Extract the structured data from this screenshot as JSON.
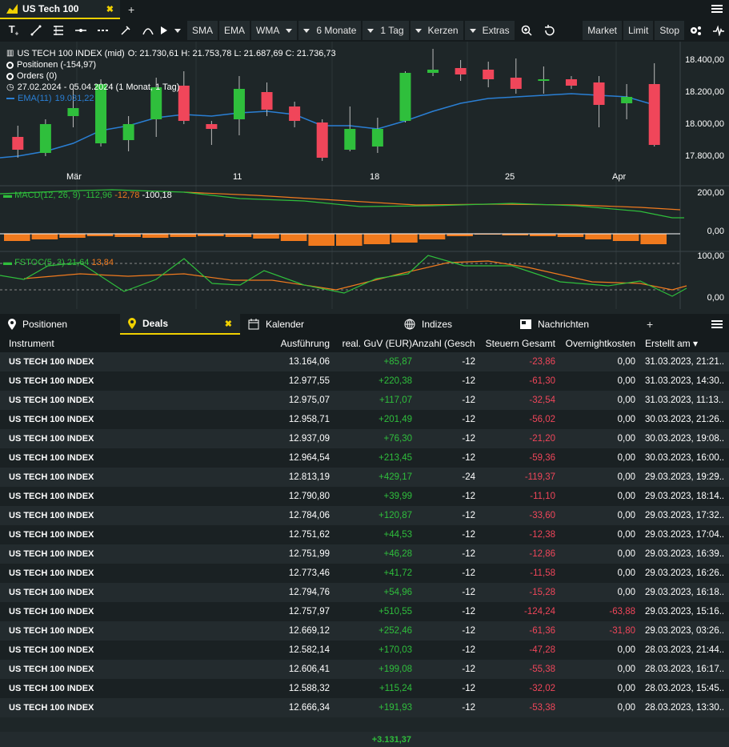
{
  "tab": {
    "title": "US Tech 100"
  },
  "toolbar": {
    "items": [
      {
        "label": "SMA",
        "dd": false
      },
      {
        "label": "EMA",
        "dd": false
      },
      {
        "label": "WMA",
        "dd": true
      },
      {
        "label": "6 Monate",
        "dd": true
      },
      {
        "label": "1 Tag",
        "dd": true
      },
      {
        "label": "Kerzen",
        "dd": true
      },
      {
        "label": "Extras",
        "dd": false
      }
    ],
    "market": "Market",
    "limit": "Limit",
    "stop": "Stop"
  },
  "legend": {
    "instrument": "US TECH 100 INDEX (mid)",
    "ohlc": "O: 21.730,61  H: 21.753,78  L: 21.687,69  C: 21.736,73",
    "positionen": "Positionen (-154,97)",
    "orders": "Orders (0)",
    "range": "27.02.2024 - 05.04.2024   (1 Monat, 1 Tag)",
    "ema": "EMA(11)",
    "ema_val": "19.031,22"
  },
  "colors": {
    "up": "#2fbf3c",
    "down": "#f0465a",
    "ema": "#2a7fd4",
    "macd": "#2fbf3c",
    "signal": "#f07a1e",
    "accent": "#f0d000"
  },
  "chart_data": {
    "type": "candlestick",
    "y_ticks": [
      "18.400,00",
      "18.200,00",
      "18.000,00",
      "17.800,00"
    ],
    "x_ticks": [
      "Mär",
      "11",
      "18",
      "25",
      "Apr"
    ],
    "candles": [
      {
        "o": 17920,
        "c": 17840,
        "h": 17990,
        "l": 17790
      },
      {
        "o": 17820,
        "c": 18000,
        "h": 18030,
        "l": 17800
      },
      {
        "o": 18050,
        "c": 18100,
        "h": 18220,
        "l": 17980
      },
      {
        "o": 17880,
        "c": 18250,
        "h": 18280,
        "l": 17860
      },
      {
        "o": 17900,
        "c": 18000,
        "h": 18050,
        "l": 17830
      },
      {
        "o": 18030,
        "c": 18230,
        "h": 18290,
        "l": 17920
      },
      {
        "o": 18240,
        "c": 18020,
        "h": 18330,
        "l": 18000
      },
      {
        "o": 18000,
        "c": 17970,
        "h": 18020,
        "l": 17870
      },
      {
        "o": 18030,
        "c": 18220,
        "h": 18300,
        "l": 17930
      },
      {
        "o": 18200,
        "c": 18090,
        "h": 18260,
        "l": 18050
      },
      {
        "o": 18110,
        "c": 18020,
        "h": 18140,
        "l": 17980
      },
      {
        "o": 18010,
        "c": 17790,
        "h": 18030,
        "l": 17770
      },
      {
        "o": 17840,
        "c": 17970,
        "h": 18110,
        "l": 17830
      },
      {
        "o": 17860,
        "c": 17970,
        "h": 18040,
        "l": 17820
      },
      {
        "o": 18020,
        "c": 18320,
        "h": 18330,
        "l": 18010
      },
      {
        "o": 18320,
        "c": 18340,
        "h": 18470,
        "l": 18300
      },
      {
        "o": 18350,
        "c": 18310,
        "h": 18400,
        "l": 18270
      },
      {
        "o": 18340,
        "c": 18280,
        "h": 18390,
        "l": 18230
      },
      {
        "o": 18290,
        "c": 18220,
        "h": 18410,
        "l": 18190
      },
      {
        "o": 18280,
        "c": 18280,
        "h": 18360,
        "l": 18190
      },
      {
        "o": 18280,
        "c": 18240,
        "h": 18300,
        "l": 18220
      },
      {
        "o": 18260,
        "c": 18120,
        "h": 18300,
        "l": 17980
      },
      {
        "o": 18130,
        "c": 18170,
        "h": 18250,
        "l": 18030
      },
      {
        "o": 18250,
        "c": 17870,
        "h": 18380,
        "l": 17860
      }
    ],
    "ema": [
      17800,
      17830,
      17880,
      17960,
      17990,
      18040,
      18060,
      18050,
      18070,
      18080,
      18060,
      17990,
      17990,
      17970,
      18020,
      18080,
      18130,
      18160,
      18170,
      18180,
      18190,
      18180,
      18170,
      18120
    ]
  },
  "macd": {
    "label": "MACD(12, 26, 9)",
    "v1": "-112,96",
    "v2": "-12,78",
    "v3": "-100,18",
    "ticks": [
      "200,00",
      "0,00"
    ]
  },
  "fstoc": {
    "label": "FSTOC(5, 3)",
    "v1": "21,64",
    "v2": "13,84",
    "ticks": [
      "100,00",
      "0,00"
    ]
  },
  "bottom_tabs": [
    {
      "label": "Positionen",
      "icon": "pin-icon"
    },
    {
      "label": "Deals",
      "icon": "pin-icon"
    },
    {
      "label": "Kalender",
      "icon": "calendar-icon"
    },
    {
      "label": "Indizes",
      "icon": "globe-icon"
    },
    {
      "label": "Nachrichten",
      "icon": "news-icon"
    }
  ],
  "table": {
    "headers": [
      "Instrument",
      "Ausführung",
      "real. GuV (EUR)",
      "Anzahl (Geschl",
      "Steuern Gesamt",
      "Overnightkosten",
      "Erstellt am"
    ],
    "rows": [
      [
        "US TECH 100 INDEX",
        "13.164,06",
        "+85,87",
        "-12",
        "-23,86",
        "0,00",
        "31.03.2023, 21:21..."
      ],
      [
        "US TECH 100 INDEX",
        "12.977,55",
        "+220,38",
        "-12",
        "-61,30",
        "0,00",
        "31.03.2023, 14:30..."
      ],
      [
        "US TECH 100 INDEX",
        "12.975,07",
        "+117,07",
        "-12",
        "-32,54",
        "0,00",
        "31.03.2023, 11:13..."
      ],
      [
        "US TECH 100 INDEX",
        "12.958,71",
        "+201,49",
        "-12",
        "-56,02",
        "0,00",
        "30.03.2023, 21:26..."
      ],
      [
        "US TECH 100 INDEX",
        "12.937,09",
        "+76,30",
        "-12",
        "-21,20",
        "0,00",
        "30.03.2023, 19:08..."
      ],
      [
        "US TECH 100 INDEX",
        "12.964,54",
        "+213,45",
        "-12",
        "-59,36",
        "0,00",
        "30.03.2023, 16:00..."
      ],
      [
        "US TECH 100 INDEX",
        "12.813,19",
        "+429,17",
        "-24",
        "-119,37",
        "0,00",
        "29.03.2023, 19:29..."
      ],
      [
        "US TECH 100 INDEX",
        "12.790,80",
        "+39,99",
        "-12",
        "-11,10",
        "0,00",
        "29.03.2023, 18:14..."
      ],
      [
        "US TECH 100 INDEX",
        "12.784,06",
        "+120,87",
        "-12",
        "-33,60",
        "0,00",
        "29.03.2023, 17:32..."
      ],
      [
        "US TECH 100 INDEX",
        "12.751,62",
        "+44,53",
        "-12",
        "-12,38",
        "0,00",
        "29.03.2023, 17:04..."
      ],
      [
        "US TECH 100 INDEX",
        "12.751,99",
        "+46,28",
        "-12",
        "-12,86",
        "0,00",
        "29.03.2023, 16:39..."
      ],
      [
        "US TECH 100 INDEX",
        "12.773,46",
        "+41,72",
        "-12",
        "-11,58",
        "0,00",
        "29.03.2023, 16:26..."
      ],
      [
        "US TECH 100 INDEX",
        "12.794,76",
        "+54,96",
        "-12",
        "-15,28",
        "0,00",
        "29.03.2023, 16:18..."
      ],
      [
        "US TECH 100 INDEX",
        "12.757,97",
        "+510,55",
        "-12",
        "-124,24",
        "-63,88",
        "29.03.2023, 15:16..."
      ],
      [
        "US TECH 100 INDEX",
        "12.669,12",
        "+252,46",
        "-12",
        "-61,36",
        "-31,80",
        "29.03.2023, 03:26..."
      ],
      [
        "US TECH 100 INDEX",
        "12.582,14",
        "+170,03",
        "-12",
        "-47,28",
        "0,00",
        "28.03.2023, 21:44..."
      ],
      [
        "US TECH 100 INDEX",
        "12.606,41",
        "+199,08",
        "-12",
        "-55,38",
        "0,00",
        "28.03.2023, 16:17..."
      ],
      [
        "US TECH 100 INDEX",
        "12.588,32",
        "+115,24",
        "-12",
        "-32,02",
        "0,00",
        "28.03.2023, 15:45..."
      ],
      [
        "US TECH 100 INDEX",
        "12.666,34",
        "+191,93",
        "-12",
        "-53,38",
        "0,00",
        "28.03.2023, 13:30..."
      ]
    ],
    "total": "+3.131,37"
  }
}
